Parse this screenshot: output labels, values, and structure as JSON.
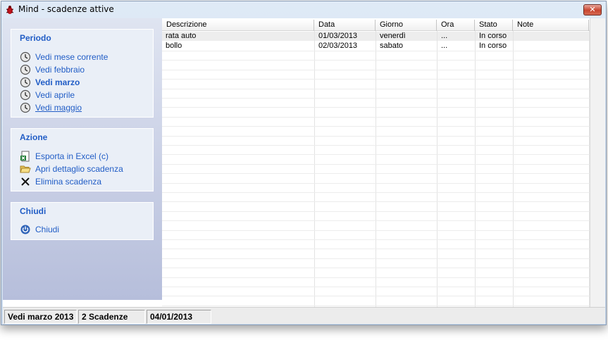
{
  "window": {
    "title": "Mind - scadenze attive",
    "close_label": "✕"
  },
  "sidebar": {
    "periodo": {
      "header": "Periodo",
      "items": [
        {
          "label": "Vedi mese corrente",
          "icon": "clock-icon"
        },
        {
          "label": "Vedi febbraio",
          "icon": "clock-icon"
        },
        {
          "label": "Vedi marzo",
          "icon": "clock-icon"
        },
        {
          "label": "Vedi aprile",
          "icon": "clock-icon"
        },
        {
          "label": "Vedi maggio",
          "icon": "clock-icon"
        }
      ]
    },
    "azione": {
      "header": "Azione",
      "items": [
        {
          "label": "Esporta in Excel (c)",
          "icon": "excel-icon"
        },
        {
          "label": "Apri dettaglio scadenza",
          "icon": "folder-open-icon"
        },
        {
          "label": "Elimina scadenza",
          "icon": "delete-x-icon"
        }
      ]
    },
    "chiudi": {
      "header": "Chiudi",
      "items": [
        {
          "label": "Chiudi",
          "icon": "power-icon"
        }
      ]
    }
  },
  "grid": {
    "columns": [
      "Descrizione",
      "Data",
      "Giorno",
      "Ora",
      "Stato",
      "Note"
    ],
    "rows": [
      [
        "rata auto",
        "01/03/2013",
        "venerdì",
        "...",
        "In corso",
        ""
      ],
      [
        "bollo",
        "02/03/2013",
        "sabato",
        "...",
        "In corso",
        ""
      ]
    ]
  },
  "status": {
    "period": "Vedi marzo 2013",
    "count": "2 Scadenze",
    "date": "04/01/2013"
  },
  "colors": {
    "link": "#215dc6",
    "sidebar_top": "#dfe4f1",
    "sidebar_bottom": "#b6bedb",
    "close": "#c8452f"
  }
}
